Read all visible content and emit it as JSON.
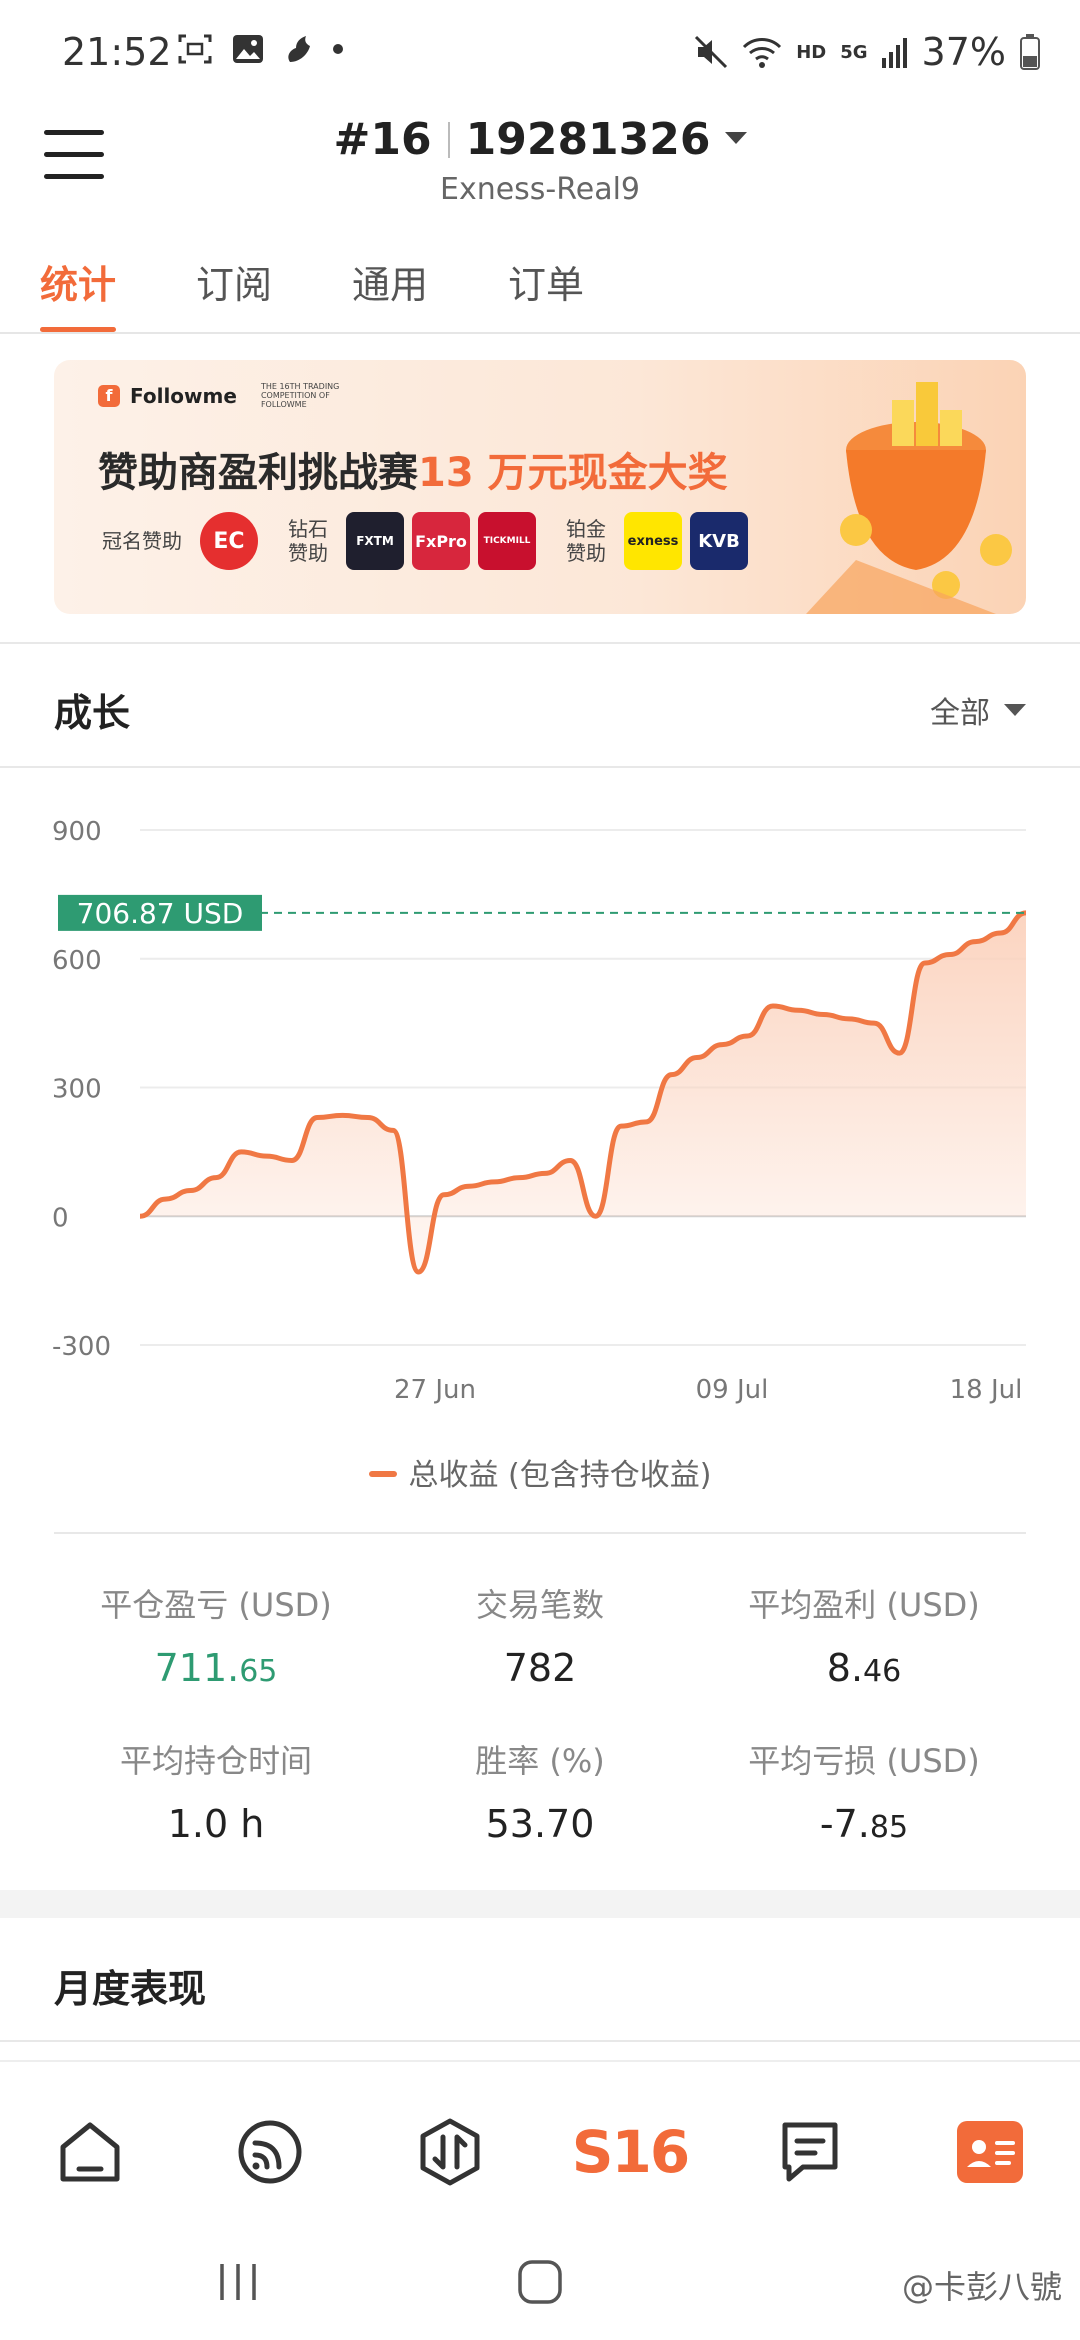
{
  "status_bar": {
    "time": "21:52",
    "network_hd": "HD",
    "network_5g": "5G",
    "battery": "37%"
  },
  "header": {
    "account_rank": "#16",
    "account_id": "19281326",
    "server": "Exness-Real9"
  },
  "tabs": [
    {
      "label": "统计",
      "active": true
    },
    {
      "label": "订阅",
      "active": false
    },
    {
      "label": "通用",
      "active": false
    },
    {
      "label": "订单",
      "active": false
    }
  ],
  "banner": {
    "brand": "Followme",
    "brand_small": "THE 16TH TRADING COMPETITION OF FOLLOWME",
    "title_main": "赞助商盈利挑战赛",
    "title_highlight": "13 万元现金大奖",
    "title_sponsor": "冠名赞助",
    "diamond_label_1": "钻石",
    "diamond_label_2": "赞助",
    "platinum_label_1": "铂金",
    "platinum_label_2": "赞助",
    "sponsors": {
      "ec": "EC",
      "fxtm": "FXTM",
      "fxpro": "FxPro",
      "tickmill": "TICKMILL",
      "exness": "exness",
      "kvb": "KVB"
    }
  },
  "growth": {
    "title": "成长",
    "range": "全部",
    "current_label": "706.87 USD",
    "legend": "总收益 (包含持仓收益)"
  },
  "chart_data": {
    "type": "area",
    "y_ticks": [
      "900",
      "600",
      "300",
      "0",
      "-300"
    ],
    "x_ticks": [
      "27 Jun",
      "09 Jul",
      "18 Jul"
    ],
    "ylim": [
      -300,
      900
    ],
    "current_value": 706.87,
    "series": [
      {
        "name": "总收益 (包含持仓收益)",
        "values": [
          0,
          40,
          60,
          90,
          150,
          140,
          130,
          230,
          235,
          230,
          200,
          -130,
          50,
          70,
          80,
          90,
          100,
          130,
          0,
          210,
          220,
          330,
          370,
          400,
          420,
          490,
          480,
          470,
          460,
          450,
          380,
          590,
          610,
          640,
          660,
          706.87
        ]
      }
    ],
    "colors": {
      "line": "#f07844",
      "fill": "#fbd2bd",
      "ref_line": "#2e9b72"
    }
  },
  "stats": [
    {
      "label": "平仓盈亏 (USD)",
      "int": "711.",
      "dec": "65",
      "green": true
    },
    {
      "label": "交易笔数",
      "int": "782",
      "dec": "",
      "green": false
    },
    {
      "label": "平均盈利 (USD)",
      "int": "8.",
      "dec": "46",
      "green": false
    },
    {
      "label": "平均持仓时间",
      "int": "1.0 h",
      "dec": "",
      "green": false
    },
    {
      "label": "胜率 (%)",
      "int": "53.70",
      "dec": "",
      "green": false
    },
    {
      "label": "平均亏损 (USD)",
      "int": "-7.",
      "dec": "85",
      "green": false
    }
  ],
  "monthly": {
    "title": "月度表现"
  },
  "bottom_nav": {
    "s16": "S16"
  },
  "watermark": "@卡彭八號"
}
